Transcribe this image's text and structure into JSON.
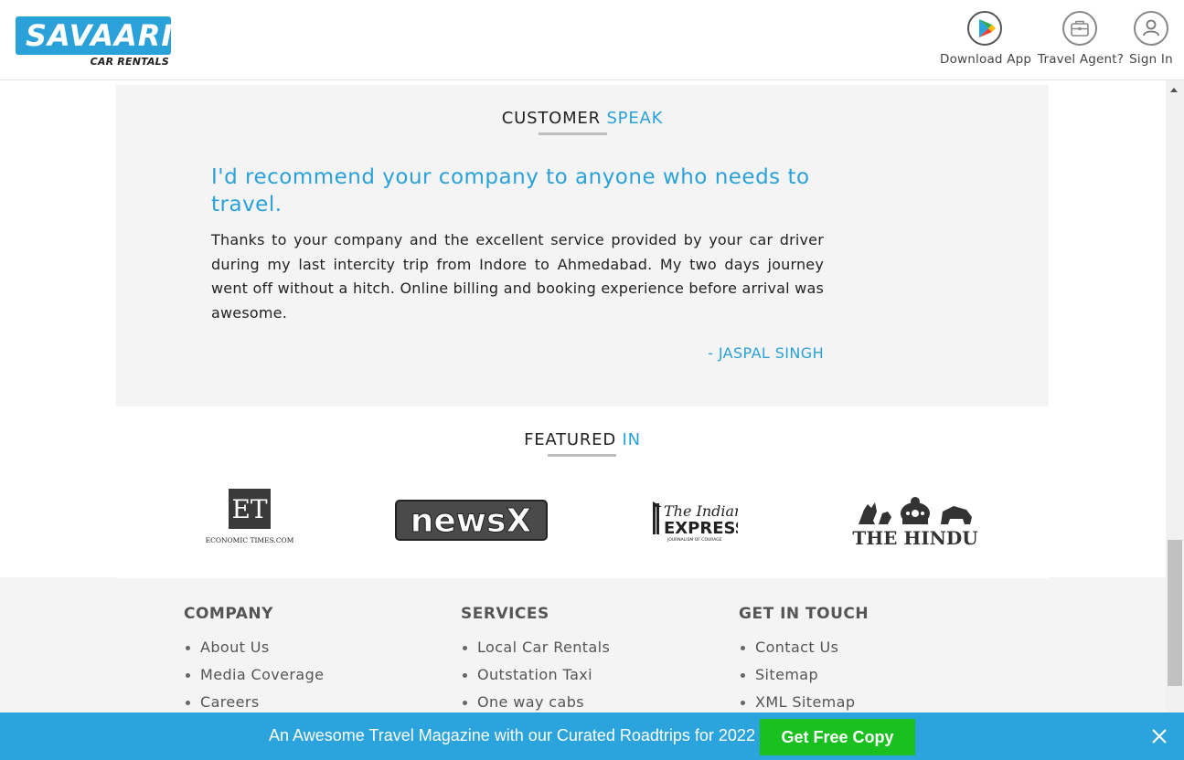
{
  "header": {
    "logo_text": "SAVAARI",
    "logo_sub": "CAR RENTALS",
    "download_app": "Download App",
    "travel_agent": "Travel Agent?",
    "sign_in": "Sign In"
  },
  "customer_speak": {
    "title_main": "CUSTOMER",
    "title_accent": "SPEAK",
    "quote": "I'd recommend your company to anyone who needs to travel.",
    "review": "Thanks to your company and the excellent service provided by your car driver during my last intercity trip from Indore to Ahmedabad. My two days journey went off without a hitch. Online billing and booking experience before arrival was awesome.",
    "author": "- JASPAL SINGH"
  },
  "featured": {
    "title_main": "FEATURED",
    "title_accent": "IN",
    "logos": [
      {
        "name": "economic-times",
        "mark": "ET",
        "caption": "ECONOMIC TIMES.COM"
      },
      {
        "name": "newsx",
        "mark": "newsX"
      },
      {
        "name": "indian-express",
        "line1": "The Indian",
        "line2": "EXPRESS",
        "tag": "JOURNALISM OF COURAGE"
      },
      {
        "name": "the-hindu",
        "mark": "THE HINDU"
      }
    ]
  },
  "footer": {
    "company": {
      "title": "COMPANY",
      "links": [
        "About Us",
        "Media Coverage",
        "Careers"
      ]
    },
    "services": {
      "title": "SERVICES",
      "links": [
        "Local Car Rentals",
        "Outstation Taxi",
        "One way cabs"
      ]
    },
    "contact": {
      "title": "GET IN TOUCH",
      "links": [
        "Contact Us",
        "Sitemap",
        "XML Sitemap"
      ]
    }
  },
  "promo": {
    "text": "An Awesome Travel Magazine with our Curated Roadtrips for 2022",
    "button": "Get Free Copy"
  },
  "colors": {
    "brand": "#2aa1d8",
    "promo_bar": "#2ba3dc",
    "cta": "#19c01f"
  }
}
